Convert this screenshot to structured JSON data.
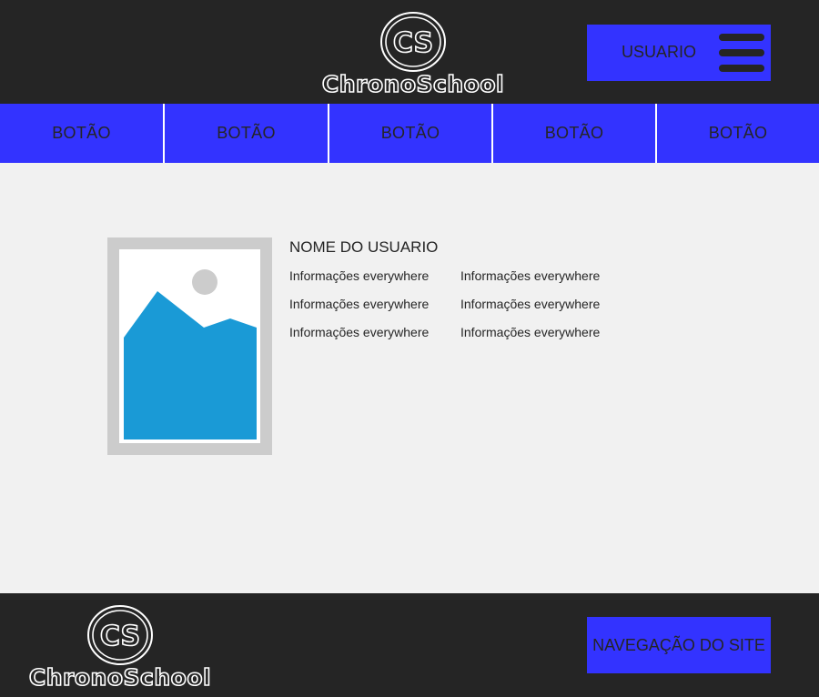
{
  "brand": {
    "monogram": "CS",
    "name": "ChronoSchool"
  },
  "header": {
    "user_label": "USUARIO"
  },
  "nav": {
    "buttons": [
      {
        "label": "BOTÃO"
      },
      {
        "label": "BOTÃO"
      },
      {
        "label": "BOTÃO"
      },
      {
        "label": "BOTÃO"
      },
      {
        "label": "BOTÃO"
      }
    ]
  },
  "profile": {
    "name": "NOME DO USUARIO",
    "info_left": [
      "Informações everywhere",
      "Informações everywhere",
      "Informações everywhere"
    ],
    "info_right": [
      "Informações everywhere",
      "Informações everywhere",
      "Informações everywhere"
    ]
  },
  "footer": {
    "site_nav_label": "NAVEGAÇÃO DO SITE"
  },
  "colors": {
    "dark": "#252525",
    "accent": "#3333ff",
    "background": "#f1f1f1",
    "image_frame": "#cccccc",
    "image_mountain": "#1a9ad6"
  }
}
